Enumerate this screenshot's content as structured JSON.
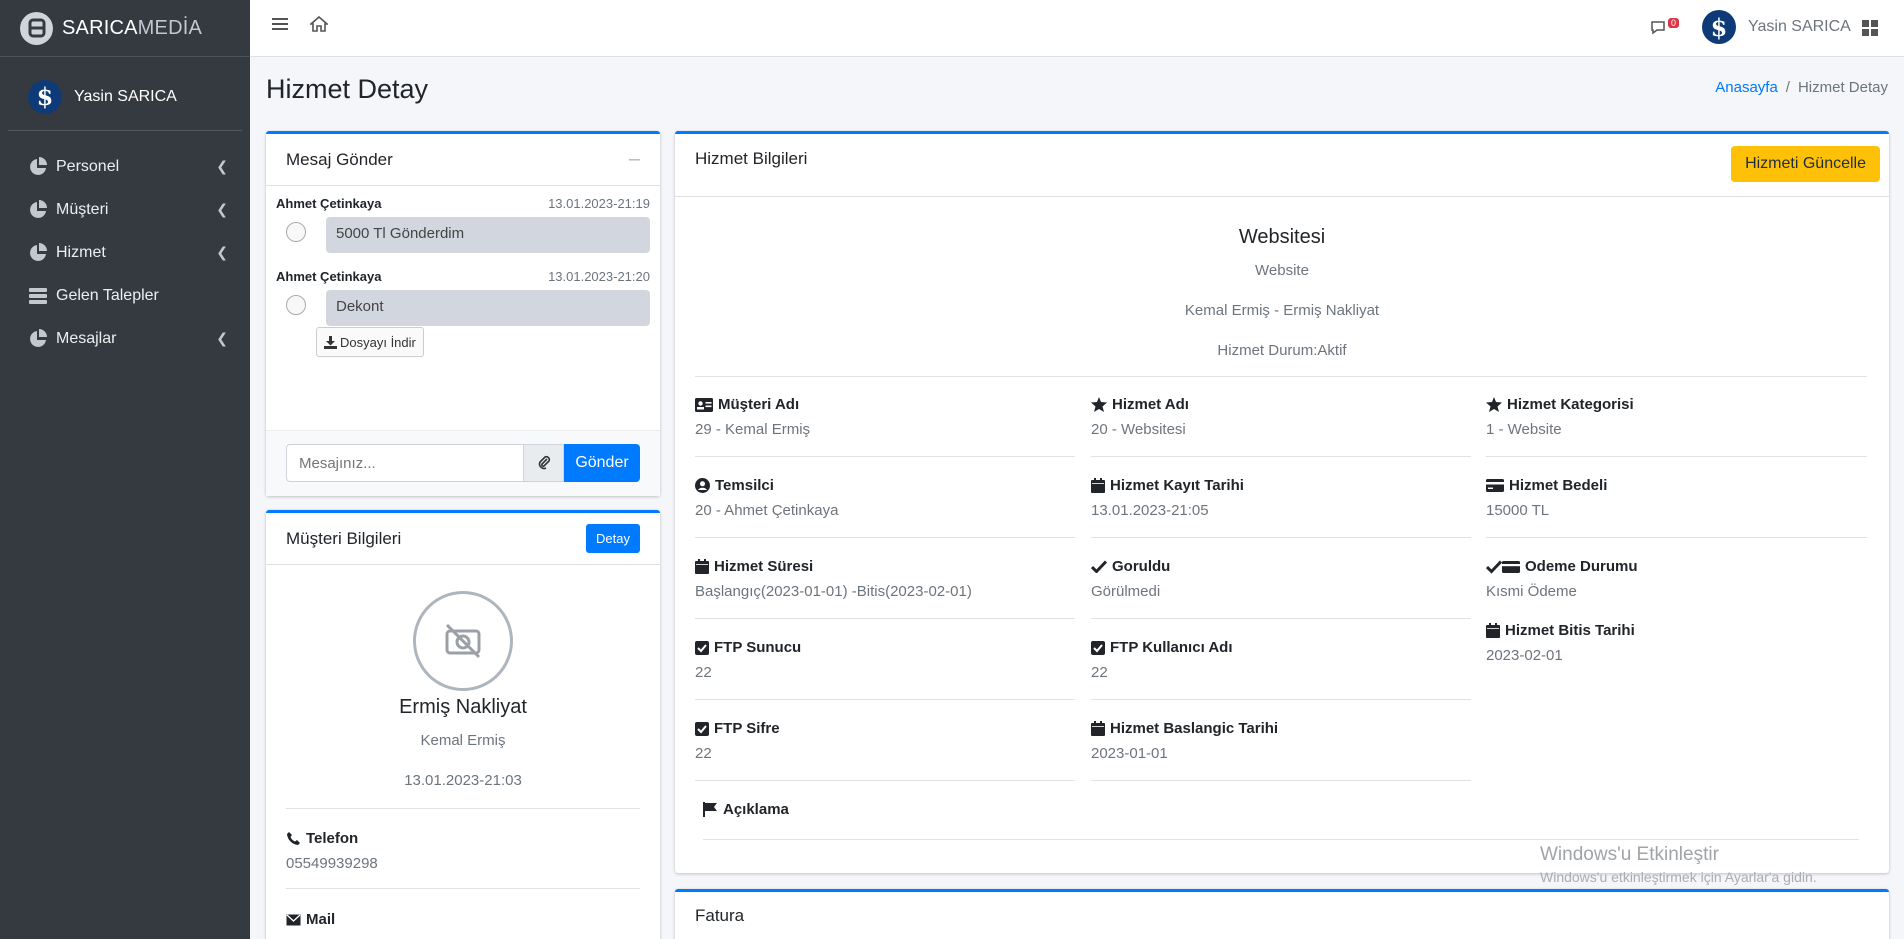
{
  "brand": {
    "name_bold": "SARICA",
    "name_light": "MEDİA"
  },
  "user": {
    "name": "Yasin SARICA"
  },
  "sidebar": {
    "items": [
      {
        "label": "Personel",
        "icon": "chart-pie-icon",
        "has_children": true
      },
      {
        "label": "Müşteri",
        "icon": "chart-pie-icon",
        "has_children": true
      },
      {
        "label": "Hizmet",
        "icon": "chart-pie-icon",
        "has_children": true
      },
      {
        "label": "Gelen Talepler",
        "icon": "server-icon",
        "has_children": false
      },
      {
        "label": "Mesajlar",
        "icon": "chart-pie-icon",
        "has_children": true
      }
    ]
  },
  "topbar": {
    "notification_count": "0"
  },
  "page": {
    "title": "Hizmet Detay"
  },
  "breadcrumb": {
    "home": "Anasayfa",
    "current": "Hizmet Detay"
  },
  "chat": {
    "title": "Mesaj Gönder",
    "messages": [
      {
        "name": "Ahmet Çetinkaya",
        "time": "13.01.2023-21:19",
        "text": "5000 Tl Gönderdim"
      },
      {
        "name": "Ahmet Çetinkaya",
        "time": "13.01.2023-21:20",
        "text": "Dekont"
      }
    ],
    "download_label": "Dosyayı İndir",
    "input_placeholder": "Mesajınız...",
    "send_label": "Gönder"
  },
  "customer": {
    "title": "Müşteri Bilgileri",
    "detail_label": "Detay",
    "company": "Ermiş Nakliyat",
    "name": "Kemal Ermiş",
    "date": "13.01.2023-21:03",
    "phone_label": "Telefon",
    "phone": "05549939298",
    "mail_label": "Mail"
  },
  "service": {
    "title": "Hizmet Bilgileri",
    "update_label": "Hizmeti Güncelle",
    "name": "Websitesi",
    "category": "Website",
    "customer_line": "Kemal Ermiş - Ermiş Nakliyat",
    "status_line": "Hizmet Durum:Aktif",
    "fields": {
      "musteri_adi": {
        "label": "Müşteri Adı",
        "value": "29 - Kemal Ermiş"
      },
      "hizmet_adi": {
        "label": "Hizmet Adı",
        "value": "20 - Websitesi"
      },
      "hizmet_kategorisi": {
        "label": "Hizmet Kategorisi",
        "value": "1 - Website"
      },
      "temsilci": {
        "label": "Temsilci",
        "value": "20 - Ahmet Çetinkaya"
      },
      "kayit_tarihi": {
        "label": "Hizmet Kayıt Tarihi",
        "value": "13.01.2023-21:05"
      },
      "bedel": {
        "label": "Hizmet Bedeli",
        "value": "15000 TL"
      },
      "sure": {
        "label": "Hizmet Süresi",
        "value": "Başlangıç(2023-01-01) -Bitis(2023-02-01)"
      },
      "goruldu": {
        "label": "Goruldu",
        "value": "Görülmedi"
      },
      "odeme": {
        "label": "Odeme Durumu",
        "value": "Kısmi Ödeme"
      },
      "bitis": {
        "label": "Hizmet Bitis Tarihi",
        "value": "2023-02-01"
      },
      "ftp_sunucu": {
        "label": "FTP Sunucu",
        "value": "22"
      },
      "ftp_kullanici": {
        "label": "FTP Kullanıcı Adı",
        "value": "22"
      },
      "ftp_sifre": {
        "label": "FTP Sifre",
        "value": "22"
      },
      "baslangic": {
        "label": "Hizmet Baslangic Tarihi",
        "value": "2023-01-01"
      },
      "aciklama": {
        "label": "Açıklama"
      }
    }
  },
  "fatura": {
    "title": "Fatura"
  },
  "watermark": {
    "line1": "Windows'u Etkinleştir",
    "line2": "Windows'u etkinleştirmek için Ayarlar'a gidin."
  },
  "colors": {
    "primary": "#007bff",
    "warning": "#ffc107",
    "sidebar": "#343a40",
    "danger": "#dc3545"
  }
}
